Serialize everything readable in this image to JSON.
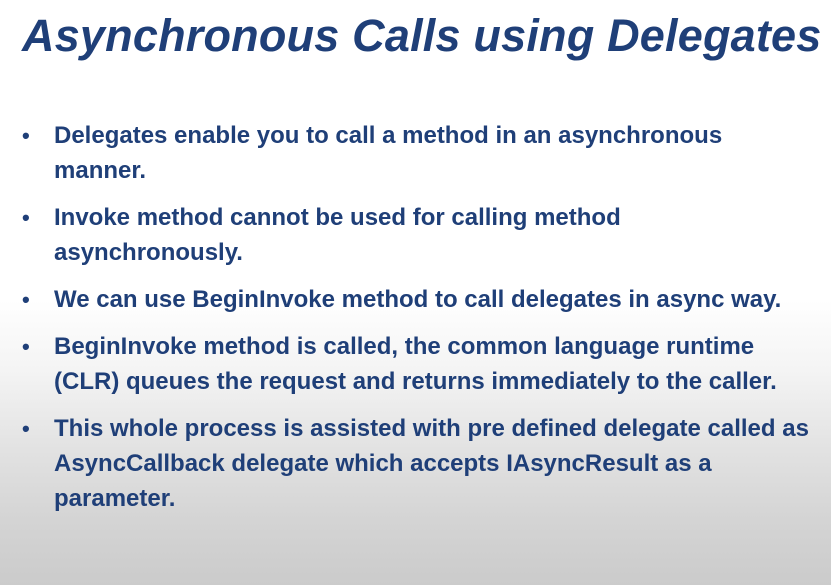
{
  "slide": {
    "title": "Asynchronous Calls using Delegates",
    "bullet_symbol": "•",
    "bullets": [
      "Delegates enable you to call a method in an asynchronous manner.",
      "Invoke method cannot be used for calling method asynchronously.",
      "We can use BeginInvoke method to call delegates in async way.",
      "BeginInvoke method is called, the common language runtime (CLR) queues the request and returns immediately to the caller.",
      "This whole process is assisted with pre defined delegate called as AsyncCallback delegate which accepts IAsyncResult as a parameter."
    ]
  }
}
